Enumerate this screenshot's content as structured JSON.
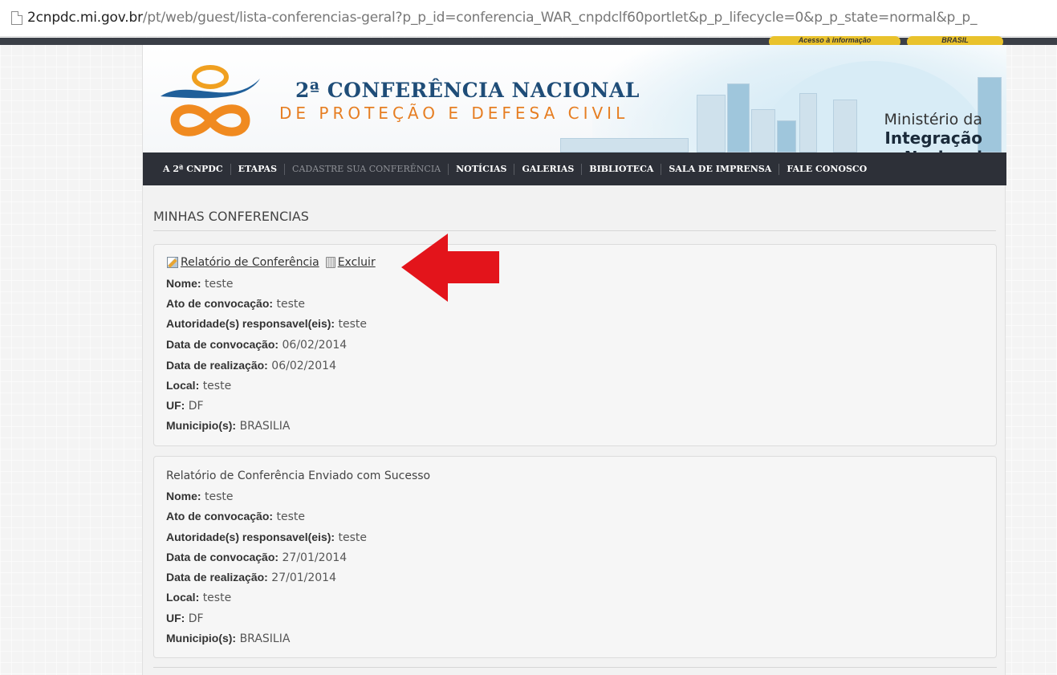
{
  "browser": {
    "url_host": "2cnpdc.mi.gov.br",
    "url_path": "/pt/web/guest/lista-conferencias-geral?p_p_id=conferencia_WAR_cnpdclf60portlet&p_p_lifecycle=0&p_p_state=normal&p_p_"
  },
  "top_bar": {
    "access_info": "Acesso à informação",
    "brasil": "BRASIL"
  },
  "header": {
    "title_line1": "2ª CONFERÊNCIA NACIONAL",
    "title_line2": "DE PROTEÇÃO E DEFESA CIVIL",
    "ministry_line1": "Ministério da",
    "ministry_line2": "Integração Nacional"
  },
  "nav": {
    "items": [
      {
        "label": "A 2ª CNPDC",
        "enabled": true
      },
      {
        "label": "ETAPAS",
        "enabled": true
      },
      {
        "label": "CADASTRE SUA CONFERÊNCIA",
        "enabled": false
      },
      {
        "label": "NOTÍCIAS",
        "enabled": true
      },
      {
        "label": "GALERIAS",
        "enabled": true
      },
      {
        "label": "BIBLIOTECA",
        "enabled": true
      },
      {
        "label": "SALA DE IMPRENSA",
        "enabled": true
      },
      {
        "label": "FALE CONOSCO",
        "enabled": true
      }
    ]
  },
  "content": {
    "section_title": "MINHAS CONFERENCIAS",
    "labels": {
      "nome": "Nome:",
      "ato": "Ato de convocação:",
      "autoridade": "Autoridade(s) responsavel(eis):",
      "data_convocacao": "Data de convocação:",
      "data_realizacao": "Data de realização:",
      "local": "Local:",
      "uf": "UF:",
      "municipio": "Municipio(s):"
    },
    "conferences": [
      {
        "action_report": "Relatório de Conferência",
        "action_delete": "Excluir",
        "nome": "teste",
        "ato": "teste",
        "autoridade": "teste",
        "data_convocacao": "06/02/2014",
        "data_realizacao": "06/02/2014",
        "local": "teste",
        "uf": "DF",
        "municipio": "BRASILIA"
      },
      {
        "status": "Relatório de Conferência Enviado com Sucesso",
        "nome": "teste",
        "ato": "teste",
        "autoridade": "teste",
        "data_convocacao": "27/01/2014",
        "data_realizacao": "27/01/2014",
        "local": "teste",
        "uf": "DF",
        "municipio": "BRASILIA"
      }
    ]
  },
  "colors": {
    "nav_bg": "#2d3038",
    "title_blue": "#1f4d78",
    "title_orange": "#e67e22",
    "arrow_red": "#e3141b"
  }
}
